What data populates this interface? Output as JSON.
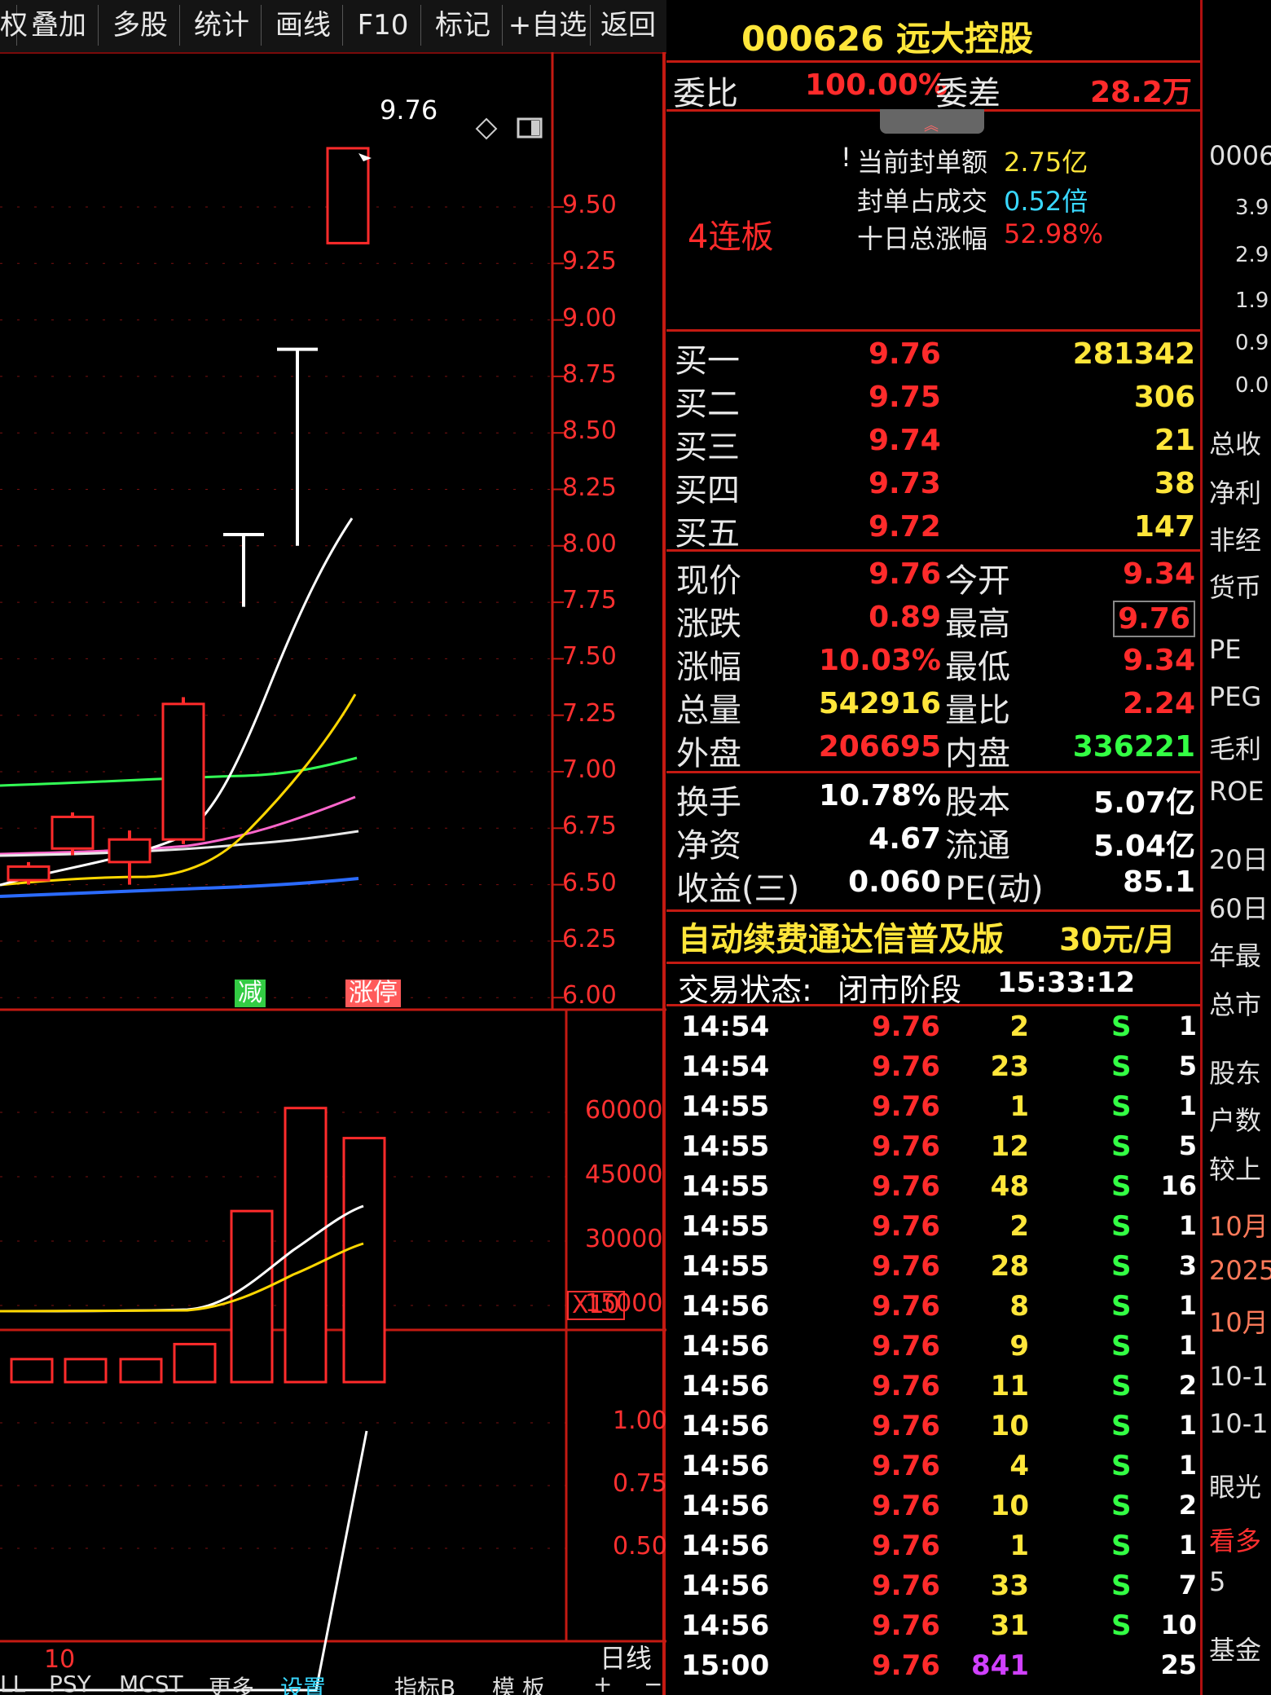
{
  "toolbar": {
    "items": [
      "权",
      "叠加",
      "多股",
      "统计",
      "画线",
      "F10",
      "标记",
      "+自选",
      "返回"
    ]
  },
  "chart": {
    "high_label": "9.76",
    "price_ticks": [
      "9.50",
      "9.25",
      "9.00",
      "8.75",
      "8.50",
      "8.25",
      "8.00",
      "7.75",
      "7.50",
      "7.25",
      "7.00",
      "6.75",
      "6.50",
      "6.25",
      "6.00"
    ],
    "badge_jian": "减",
    "badge_zhangting": "涨停",
    "volume_ticks": [
      "60000",
      "45000",
      "30000",
      "15000"
    ],
    "volume_unit": "X10",
    "indicator_ticks": [
      "1.00",
      "0.75",
      "0.50"
    ],
    "indicator_param": "10",
    "period_label": "日线",
    "bottom_tabs": [
      "LL",
      "PSY",
      "MCST",
      "更多",
      "设置",
      "指标B",
      "模 板",
      "+",
      "−"
    ],
    "colors": {
      "up": "#ff2b2b",
      "ma_white": "#ffffff",
      "ma_yellow": "#ffd700",
      "ma_pink": "#ff66cc",
      "ma_green": "#33ff55",
      "ma_blue": "#2b6bff",
      "ma_gray": "#e8e8e8"
    }
  },
  "chart_data": {
    "type": "candlestick",
    "price_axis": [
      6.0,
      9.6
    ],
    "candles": [
      {
        "open": 6.52,
        "close": 6.58,
        "high": 6.6,
        "low": 6.5
      },
      {
        "open": 6.66,
        "close": 6.8,
        "high": 6.82,
        "low": 6.63
      },
      {
        "open": 6.6,
        "close": 6.7,
        "high": 6.74,
        "low": 6.5
      },
      {
        "open": 6.7,
        "close": 7.3,
        "high": 7.33,
        "low": 6.68
      },
      {
        "open": 8.05,
        "close": 8.05,
        "high": 8.05,
        "low": 7.73
      },
      {
        "open": 8.87,
        "close": 8.87,
        "high": 8.87,
        "low": 8.0
      },
      {
        "open": 9.34,
        "close": 9.76,
        "high": 9.76,
        "low": 9.34
      }
    ],
    "volume": [
      2500,
      2500,
      2500,
      6000,
      37000,
      61000,
      54000
    ],
    "volume_axis": [
      0,
      65000
    ]
  },
  "quote": {
    "title": "000626 远大控股",
    "weibi_label": "委比",
    "weibi_value": "100.00%",
    "weicha_label": "委差",
    "weicha_value": "28.2万",
    "board_label": "4连板",
    "seal_amount_label": "当前封单额",
    "seal_amount_value": "2.75亿",
    "seal_ratio_label": "封单占成交",
    "seal_ratio_value": "0.52倍",
    "ten_day_label": "十日总涨幅",
    "ten_day_value": "52.98%",
    "bids": [
      {
        "label": "买一",
        "price": "9.76",
        "vol": "281342"
      },
      {
        "label": "买二",
        "price": "9.75",
        "vol": "306"
      },
      {
        "label": "买三",
        "price": "9.74",
        "vol": "21"
      },
      {
        "label": "买四",
        "price": "9.73",
        "vol": "38"
      },
      {
        "label": "买五",
        "price": "9.72",
        "vol": "147"
      }
    ],
    "stats1": [
      {
        "l1": "现价",
        "v1": "9.76",
        "l2": "今开",
        "v2": "9.34"
      },
      {
        "l1": "涨跌",
        "v1": "0.89",
        "l2": "最高",
        "v2": "9.76"
      },
      {
        "l1": "涨幅",
        "v1": "10.03%",
        "l2": "最低",
        "v2": "9.34"
      },
      {
        "l1": "总量",
        "v1": "542916",
        "l2": "量比",
        "v2": "2.24"
      },
      {
        "l1": "外盘",
        "v1": "206695",
        "l2": "内盘",
        "v2": "336221"
      }
    ],
    "stats2": [
      {
        "l1": "换手",
        "v1": "10.78%",
        "l2": "股本",
        "v2": "5.07亿"
      },
      {
        "l1": "净资",
        "v1": "4.67",
        "l2": "流通",
        "v2": "5.04亿"
      },
      {
        "l1": "收益(三)",
        "v1": "0.060",
        "l2": "PE(动)",
        "v2": "85.1"
      }
    ],
    "promo": "自动续费通达信普及版",
    "promo_price": "30元/月",
    "status_label": "交易状态:",
    "status_value": "闭市阶段",
    "status_time": "15:33:12",
    "ticks": [
      {
        "time": "14:54",
        "price": "9.76",
        "vol": "2",
        "side": "S",
        "n": "1"
      },
      {
        "time": "14:54",
        "price": "9.76",
        "vol": "23",
        "side": "S",
        "n": "5"
      },
      {
        "time": "14:55",
        "price": "9.76",
        "vol": "1",
        "side": "S",
        "n": "1"
      },
      {
        "time": "14:55",
        "price": "9.76",
        "vol": "12",
        "side": "S",
        "n": "5"
      },
      {
        "time": "14:55",
        "price": "9.76",
        "vol": "48",
        "side": "S",
        "n": "16"
      },
      {
        "time": "14:55",
        "price": "9.76",
        "vol": "2",
        "side": "S",
        "n": "1"
      },
      {
        "time": "14:55",
        "price": "9.76",
        "vol": "28",
        "side": "S",
        "n": "3"
      },
      {
        "time": "14:56",
        "price": "9.76",
        "vol": "8",
        "side": "S",
        "n": "1"
      },
      {
        "time": "14:56",
        "price": "9.76",
        "vol": "9",
        "side": "S",
        "n": "1"
      },
      {
        "time": "14:56",
        "price": "9.76",
        "vol": "11",
        "side": "S",
        "n": "2"
      },
      {
        "time": "14:56",
        "price": "9.76",
        "vol": "10",
        "side": "S",
        "n": "1"
      },
      {
        "time": "14:56",
        "price": "9.76",
        "vol": "4",
        "side": "S",
        "n": "1"
      },
      {
        "time": "14:56",
        "price": "9.76",
        "vol": "10",
        "side": "S",
        "n": "2"
      },
      {
        "time": "14:56",
        "price": "9.76",
        "vol": "1",
        "side": "S",
        "n": "1"
      },
      {
        "time": "14:56",
        "price": "9.76",
        "vol": "33",
        "side": "S",
        "n": "7"
      },
      {
        "time": "14:56",
        "price": "9.76",
        "vol": "31",
        "side": "S",
        "n": "10"
      },
      {
        "time": "15:00",
        "price": "9.76",
        "vol": "841",
        "side": "",
        "n": "25"
      }
    ]
  },
  "right_strip": {
    "items": [
      "0006",
      "3.9",
      "2.9",
      "1.9",
      "0.9",
      "0.0",
      "总收",
      "净利",
      "非经",
      "货币",
      "PE",
      "PEG",
      "毛利",
      "ROE",
      "20日",
      "60日",
      "年最",
      "总市",
      "股东",
      "户数",
      "较上",
      "10月",
      "2025",
      "10月",
      "10-1",
      "10-1",
      "眼光",
      "看多",
      "5",
      "基金"
    ]
  }
}
